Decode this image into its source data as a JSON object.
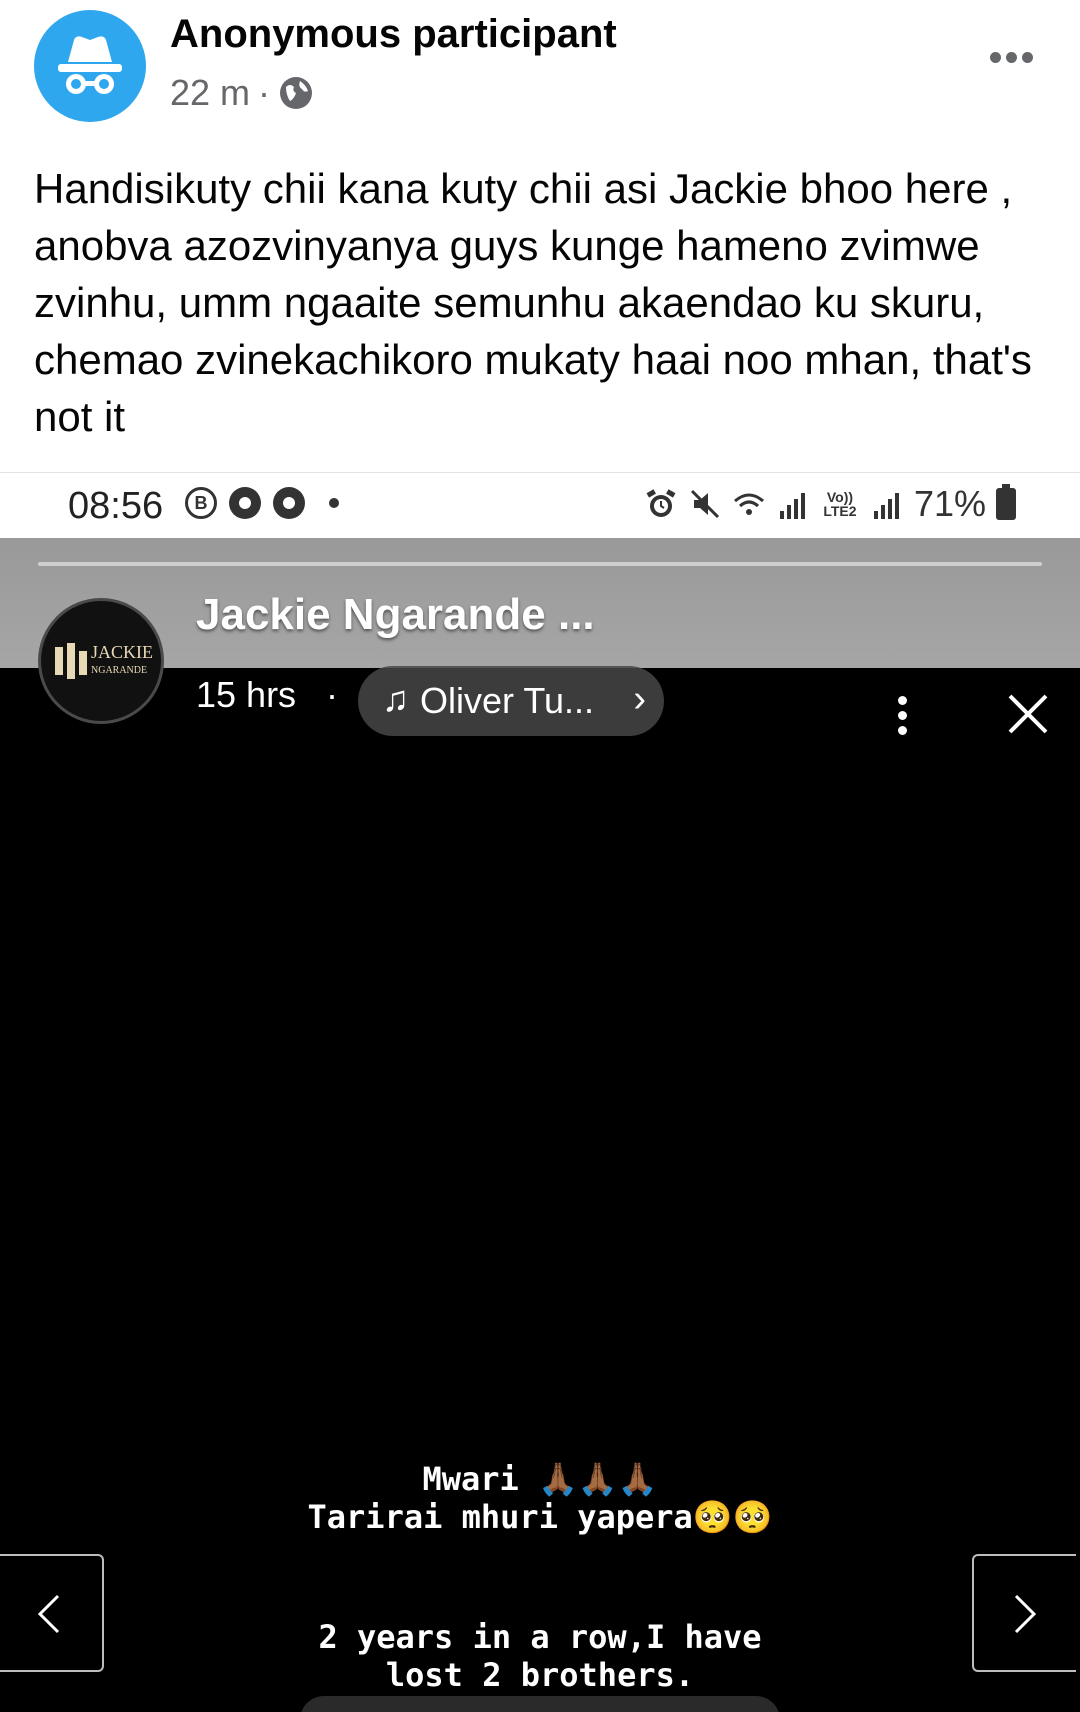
{
  "post": {
    "author": "Anonymous participant",
    "time": "22 m",
    "separator": "·",
    "text": "Handisikuty chii kana kuty chii asi Jackie bhoo here , anobva azozvinyanya guys kunge hameno zvimwe zvinhu, umm ngaaite semunhu akaendao ku skuru, chemao zvinekachikoro mukaty haai noo mhan, that's not it"
  },
  "status_bar": {
    "time": "08:56",
    "battery": "71%",
    "volte": "Vo)) LTE2"
  },
  "story": {
    "name": "Jackie Ngarande ...",
    "time": "15 hrs",
    "dot": "·",
    "music": "Oliver Tu...",
    "logo_text": "JACKIE",
    "logo_sub": "NGARANDE",
    "caption_line1": "Mwari 🙏🏾🙏🏾🙏🏾",
    "caption_line2": "Tarirai mhuri yapera🥺🥺",
    "caption_line3": "2 years in a row,I have",
    "caption_line4": "lost 2 brothers."
  },
  "colors": {
    "avatar_bg": "#2ea7ee",
    "text_primary": "#050505",
    "text_secondary": "#65676b"
  }
}
